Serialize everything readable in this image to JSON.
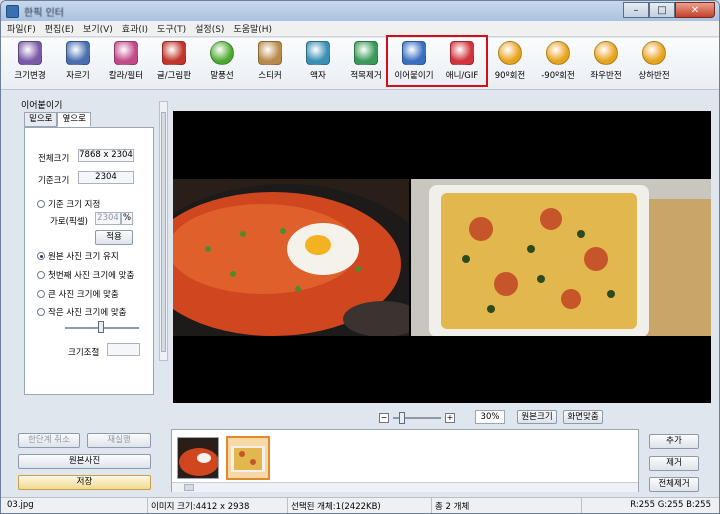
{
  "window": {
    "title": "한픽 인터"
  },
  "menu": [
    {
      "label": "파일(F)"
    },
    {
      "label": "편집(E)"
    },
    {
      "label": "보기(V)"
    },
    {
      "label": "효과(I)"
    },
    {
      "label": "도구(T)"
    },
    {
      "label": "설정(S)"
    },
    {
      "label": "도움말(H)"
    }
  ],
  "toolbar": [
    {
      "label": "크기변경",
      "icon": "resize-icon",
      "color": "#7a5aa8"
    },
    {
      "label": "자르기",
      "icon": "crop-icon",
      "color": "#4a6fb0"
    },
    {
      "label": "칼라/필터",
      "icon": "color-filter-icon",
      "color": "#c24a8a"
    },
    {
      "label": "글/그림판",
      "icon": "text-draw-icon",
      "color": "#c2342c"
    },
    {
      "label": "말풍선",
      "icon": "speech-bubble-icon",
      "color": "#4caa2e"
    },
    {
      "label": "스티커",
      "icon": "sticker-icon",
      "color": "#b88a4a"
    },
    {
      "label": "액자",
      "icon": "frame-icon",
      "color": "#3a8fb5"
    },
    {
      "label": "적목제거",
      "icon": "red-eye-icon",
      "color": "#3a9a5a"
    },
    {
      "label": "이어붙이기",
      "icon": "merge-icon",
      "color": "#3a6fc0"
    },
    {
      "label": "애니/GIF",
      "icon": "gif-icon",
      "color": "#d2333c"
    },
    {
      "label": "90º회전",
      "icon": "rotate-cw-icon",
      "color": "#e8a21c"
    },
    {
      "label": "-90º회전",
      "icon": "rotate-ccw-icon",
      "color": "#e8a21c"
    },
    {
      "label": "좌우반전",
      "icon": "flip-horizontal-icon",
      "color": "#e8a21c"
    },
    {
      "label": "상하반전",
      "icon": "flip-vertical-icon",
      "color": "#e8a21c"
    }
  ],
  "panel": {
    "title": "이어붙이기",
    "tabs": [
      "밑으로",
      "옆으로"
    ],
    "total_label": "전체크기",
    "total_value": "7868 x 2304",
    "base_label": "기준크기",
    "base_value": "2304",
    "opt_custom": "기준 크기 지정",
    "width_label": "가로(픽셀)",
    "width_value": "2304",
    "apply_label": "적용",
    "opt_original": "원본 사진 크기 유지",
    "opt_first": "첫번째 사진 크기에 맞춤",
    "opt_large": "큰 사진 크기에 맞춤",
    "opt_small": "작은 사진 크기에 맞춤",
    "adjust_label": "크기조절",
    "undo_label": "한단계 취소",
    "redo_label": "재실행",
    "original_label": "원본사진",
    "save_label": "저장"
  },
  "zoom": {
    "value": "30%",
    "fit_original": "원본크기",
    "fit_screen": "화면맞춤"
  },
  "side_buttons": {
    "add": "추가",
    "remove": "제거",
    "remove_all": "전체제거"
  },
  "status": {
    "file": "03.jpg",
    "image_size": "이미지 크기:4412 x 2938",
    "selected": "선택된 개체:1(2422KB)",
    "total": "총 2 개체",
    "rgb": "R:255 G:255 B:255"
  },
  "colors": {
    "highlight": "#d10f16",
    "accent": "#3a6fc0"
  }
}
